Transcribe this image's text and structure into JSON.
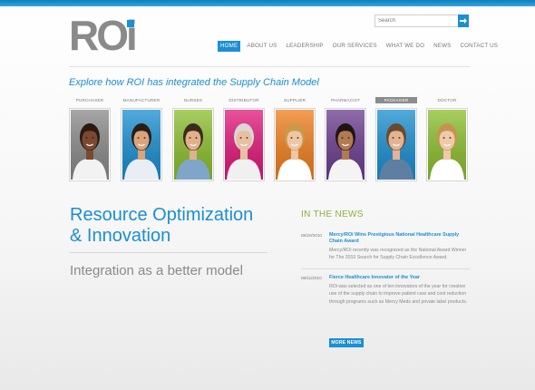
{
  "brand": {
    "logo_text": "ROi"
  },
  "search": {
    "placeholder": "Search"
  },
  "nav": {
    "items": [
      "HOME",
      "ABOUT US",
      "LEADERSHIP",
      "OUR SERVICES",
      "WHAT WE DO",
      "NEWS",
      "CONTACT US"
    ],
    "active": "HOME"
  },
  "tagline": "Explore how ROI has integrated the Supply Chain Model",
  "personas": [
    {
      "label": "PURCHASER",
      "bg": "#8a8a8a",
      "selected": false
    },
    {
      "label": "MANUFACTURER",
      "bg": "#1a8fd1",
      "selected": false
    },
    {
      "label": "NURSES",
      "bg": "#8cbf2f",
      "selected": false
    },
    {
      "label": "DISTRIBUTOR",
      "bg": "#e2187a",
      "selected": false
    },
    {
      "label": "SUPPLIER",
      "bg": "#f07f1e",
      "selected": false
    },
    {
      "label": "PHARMACIST",
      "bg": "#6b3d8f",
      "selected": false
    },
    {
      "label": "PACKAGER",
      "bg": "#1a8fd1",
      "selected": true
    },
    {
      "label": "DOCTOR",
      "bg": "#8cbf2f",
      "selected": false
    }
  ],
  "main": {
    "headline_line1": "Resource Optimization",
    "headline_line2": "& Innovation",
    "subhead": "Integration as a better model"
  },
  "news": {
    "section_title": "IN THE NEWS",
    "items": [
      {
        "date": "08/20/2010",
        "headline": "Mercy/ROi Wins Prestigious National Healthcare Supply Chain Award",
        "text": "Mercy/ROi recently was recognized as the National Award Winner for The 2010 Search for Supply Chain Excellence Award."
      },
      {
        "date": "08/11/2010",
        "headline": "Fierce Healthcare Innovator of the Year",
        "text": "ROi was selected as one of ten innovators of the year for creative use of the supply chain to improve patient care and cost reduction through programs such as Mercy Meds and private label products."
      }
    ],
    "more_label": "MORE NEWS"
  },
  "colors": {
    "accent": "#1a8fd1",
    "news_green": "#8db13a",
    "logo_gray": "#8a8a8a"
  }
}
